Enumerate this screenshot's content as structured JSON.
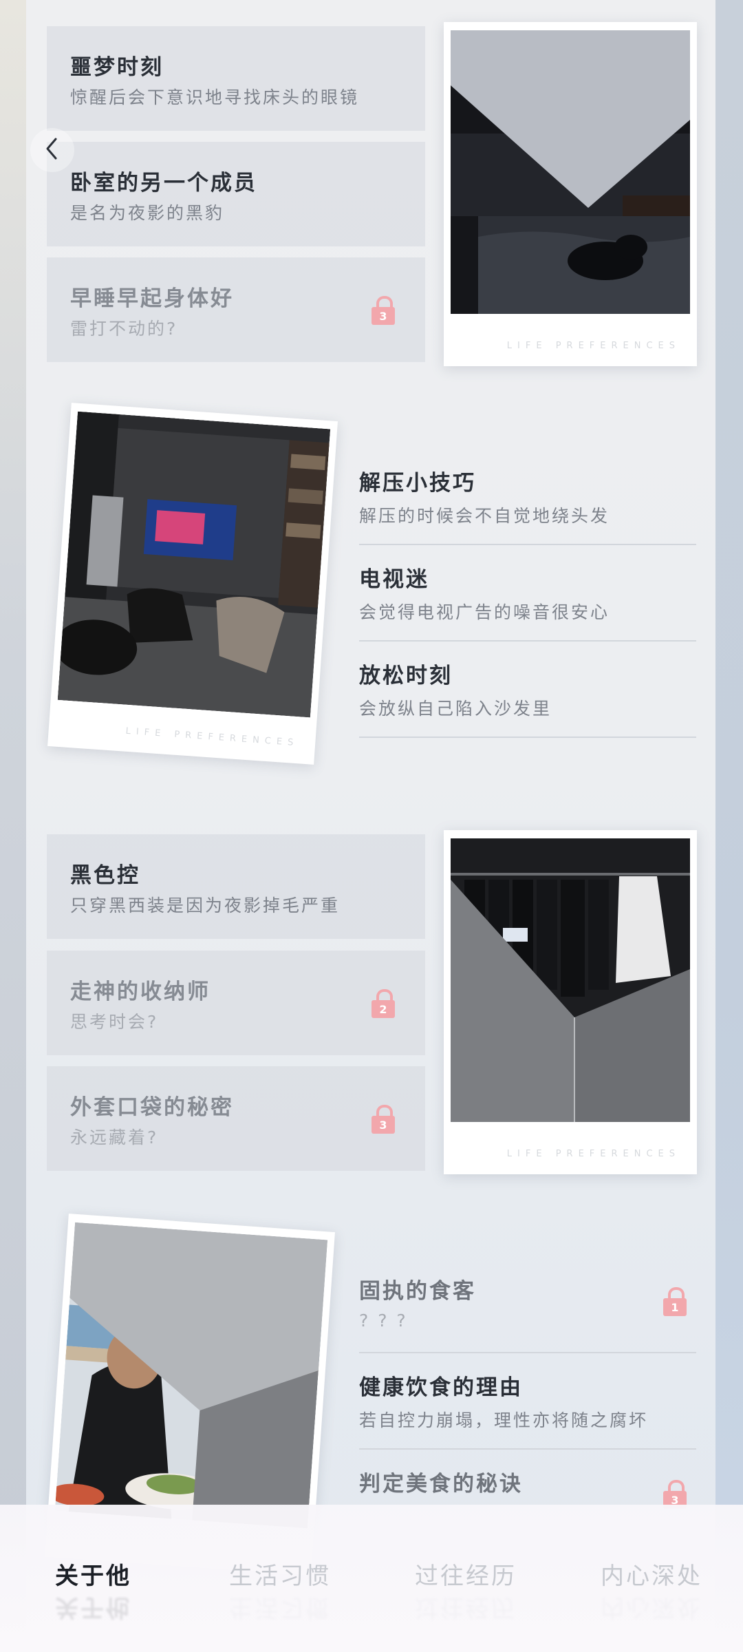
{
  "nav": {
    "back_icon": "chevron-left-icon"
  },
  "section1": {
    "cards": [
      {
        "title": "噩梦时刻",
        "subtitle": "惊醒后会下意识地寻找床头的眼镜",
        "locked": false
      },
      {
        "title": "卧室的另一个成员",
        "subtitle": "是名为夜影的黑豹",
        "locked": false
      },
      {
        "title": "早睡早起身体好",
        "subtitle": "雷打不动的?",
        "locked": true,
        "lock_number": "3"
      }
    ],
    "photo_caption": "LIFE PREFERENCES"
  },
  "section2": {
    "photo_caption": "LIFE PREFERENCES",
    "rows": [
      {
        "title": "解压小技巧",
        "subtitle": "解压的时候会不自觉地绕头发"
      },
      {
        "title": "电视迷",
        "subtitle": "会觉得电视广告的噪音很安心"
      },
      {
        "title": "放松时刻",
        "subtitle": "会放纵自己陷入沙发里"
      }
    ]
  },
  "section3": {
    "cards": [
      {
        "title": "黑色控",
        "subtitle": "只穿黑西装是因为夜影掉毛严重",
        "locked": false
      },
      {
        "title": "走神的收纳师",
        "subtitle": "思考时会?",
        "locked": true,
        "lock_number": "2"
      },
      {
        "title": "外套口袋的秘密",
        "subtitle": "永远藏着?",
        "locked": true,
        "lock_number": "3"
      }
    ],
    "photo_caption": "LIFE PREFERENCES"
  },
  "section4": {
    "rows": [
      {
        "title": "固执的食客",
        "subtitle": "? ? ?",
        "locked": true,
        "lock_number": "1"
      },
      {
        "title": "健康饮食的理由",
        "subtitle": "若自控力崩塌，理性亦将随之腐坏",
        "locked": false
      },
      {
        "title": "判定美食的秘诀",
        "subtitle": "",
        "locked": true,
        "lock_number": "3"
      }
    ]
  },
  "tabs": [
    {
      "label": "关于他",
      "active": true
    },
    {
      "label": "生活习惯",
      "active": false
    },
    {
      "label": "过往经历",
      "active": false
    },
    {
      "label": "内心深处",
      "active": false
    }
  ],
  "colors": {
    "lock": "#f2a7ac",
    "text_dark": "#2a2f37",
    "text_muted": "#7d828b"
  }
}
